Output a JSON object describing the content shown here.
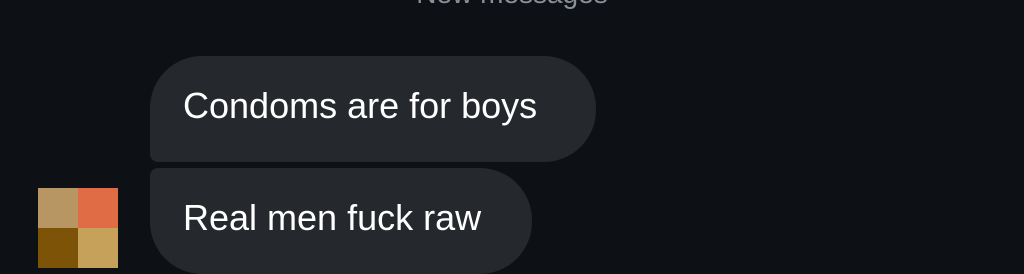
{
  "chat": {
    "divider_label": "New messages",
    "messages": [
      {
        "text": "Condoms are for boys"
      },
      {
        "text": "Real men fuck raw"
      }
    ],
    "avatar": {
      "pixel_colors": [
        "#b79664",
        "#e06c46",
        "#7d5407",
        "#c5a15a"
      ]
    }
  }
}
